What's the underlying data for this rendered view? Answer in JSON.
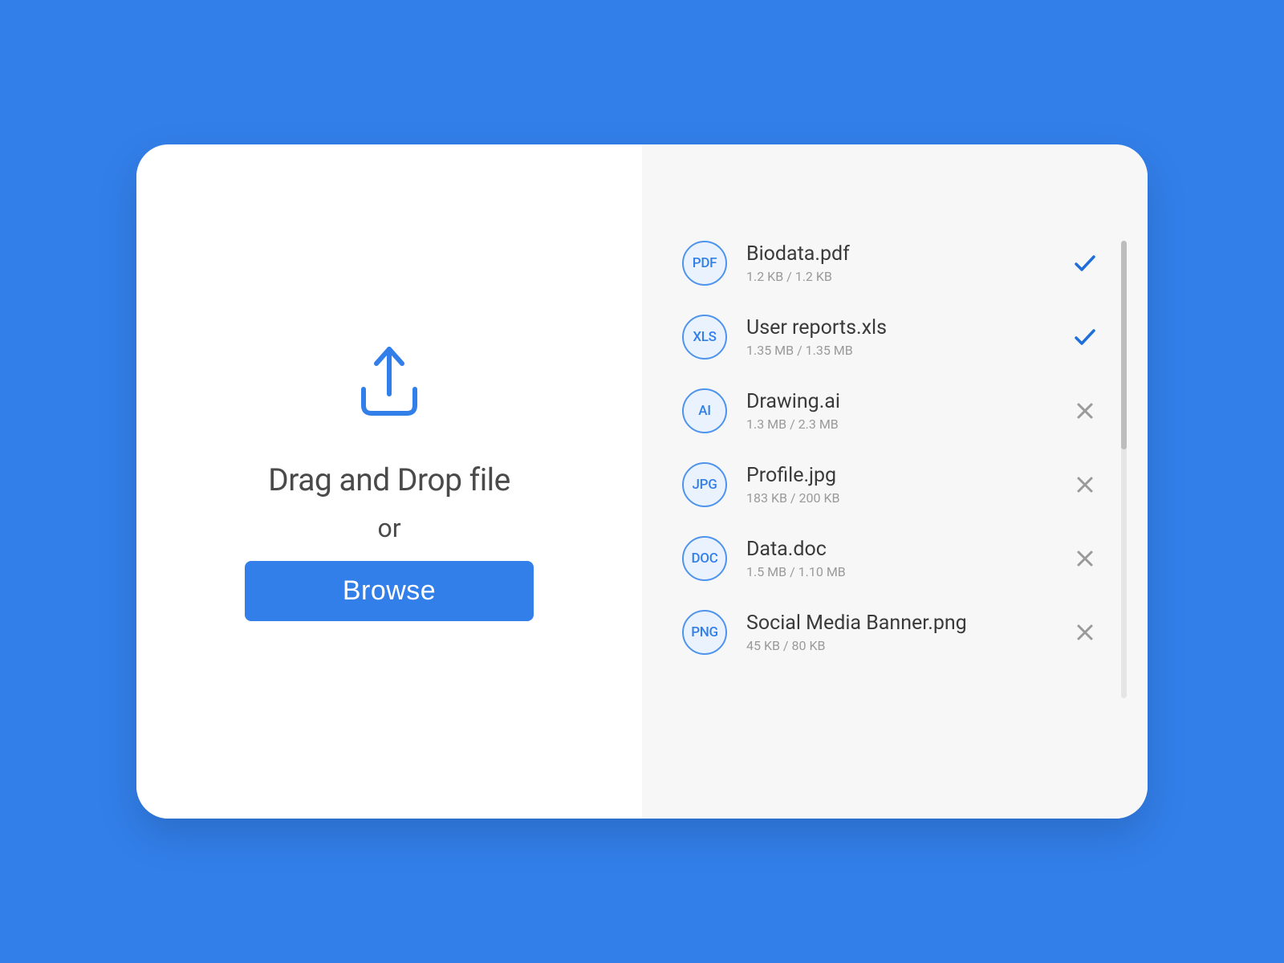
{
  "drop": {
    "title": "Drag and Drop file",
    "or": "or",
    "browse_label": "Browse"
  },
  "files": [
    {
      "badge": "PDF",
      "name": "Biodata.pdf",
      "size": "1.2 KB / 1.2 KB",
      "status": "done"
    },
    {
      "badge": "XLS",
      "name": "User reports.xls",
      "size": "1.35 MB / 1.35 MB",
      "status": "done"
    },
    {
      "badge": "AI",
      "name": "Drawing.ai",
      "size": "1.3 MB / 2.3 MB",
      "status": "cancel"
    },
    {
      "badge": "JPG",
      "name": "Profile.jpg",
      "size": "183 KB / 200 KB",
      "status": "cancel"
    },
    {
      "badge": "DOC",
      "name": "Data.doc",
      "size": "1.5 MB / 1.10 MB",
      "status": "cancel"
    },
    {
      "badge": "PNG",
      "name": "Social Media Banner.png",
      "size": "45 KB / 80 KB",
      "status": "cancel"
    }
  ],
  "colors": {
    "accent": "#327FEA"
  }
}
